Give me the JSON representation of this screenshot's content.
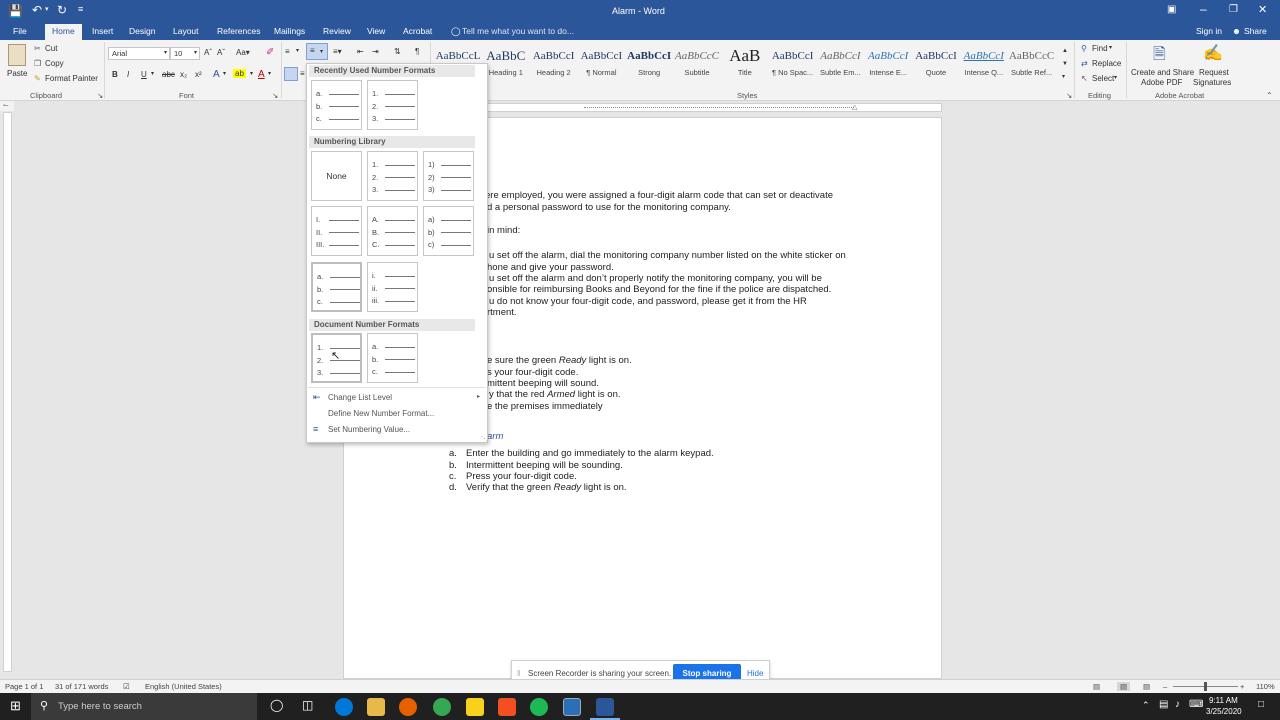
{
  "window": {
    "title": "Alarm  -  Word",
    "signin": "Sign in",
    "share": "Share"
  },
  "tabs": [
    "File",
    "Home",
    "Insert",
    "Design",
    "Layout",
    "References",
    "Mailings",
    "Review",
    "View",
    "Acrobat"
  ],
  "tell_me": "Tell me what you want to do...",
  "clipboard": {
    "paste": "Paste",
    "cut": "Cut",
    "copy": "Copy",
    "format_painter": "Format Painter",
    "label": "Clipboard"
  },
  "font": {
    "name": "Arial",
    "size": "10",
    "label": "Font"
  },
  "styles": {
    "label": "Styles",
    "items": [
      {
        "preview": "AaBbCcL",
        "name": ""
      },
      {
        "preview": "AaBbC",
        "name": "Heading 1"
      },
      {
        "preview": "AaBbCcI",
        "name": "Heading 2"
      },
      {
        "preview": "AaBbCcI",
        "name": "¶ Normal"
      },
      {
        "preview": "AaBbCcI",
        "name": "Strong"
      },
      {
        "preview": "AaBbCcC",
        "name": "Subtitle"
      },
      {
        "preview": "AaB",
        "name": "Title"
      },
      {
        "preview": "AaBbCcI",
        "name": "¶ No Spac..."
      },
      {
        "preview": "AaBbCcI",
        "name": "Subtle Em..."
      },
      {
        "preview": "AaBbCcI",
        "name": "Intense E..."
      },
      {
        "preview": "AaBbCcI",
        "name": "Quote"
      },
      {
        "preview": "AaBbCcI",
        "name": "Intense Q..."
      },
      {
        "preview": "AaBbCcC",
        "name": "Subtle Ref..."
      }
    ]
  },
  "editing": {
    "find": "Find",
    "replace": "Replace",
    "select": "Select",
    "label": "Editing"
  },
  "acrobat": {
    "create": "Create and Share",
    "create2": "Adobe PDF",
    "request": "Request",
    "request2": "Signatures",
    "label": "Adobe Acrobat"
  },
  "numbering": {
    "recent_header": "Recently Used Number Formats",
    "library_header": "Numbering Library",
    "document_header": "Document Number Formats",
    "none": "None",
    "recent": [
      [
        "a.",
        "b.",
        "c."
      ],
      [
        "1.",
        "2.",
        "3."
      ]
    ],
    "library": [
      [
        "1.",
        "2.",
        "3."
      ],
      [
        "1)",
        "2)",
        "3)"
      ],
      [
        "I.",
        "II.",
        "III."
      ],
      [
        "A.",
        "B.",
        "C."
      ],
      [
        "a)",
        "b)",
        "c)"
      ],
      [
        "a.",
        "b.",
        "c."
      ],
      [
        "i.",
        "ii.",
        "iii."
      ]
    ],
    "document": [
      [
        "1.",
        "2.",
        "3."
      ],
      [
        "a.",
        "b.",
        "c."
      ]
    ],
    "menu": [
      "Change List Level",
      "Define New Number Format...",
      "Set Numbering Value..."
    ]
  },
  "document": {
    "lines": [
      "ere employed, you were assigned a four-digit alarm code that can set or deactivate",
      "d a personal password to use for the monitoring company.",
      "in mind:",
      "u set off the alarm, dial the monitoring company number listed on the white sticker on",
      "hone and give your password.",
      "u set off the alarm and don’t properly notify the monitoring company, you will be",
      "onsible for reimbursing Books and Beyond for the fine if the police are dispatched.",
      "u do not know your four-digit code, and password, please get it from the HR",
      "rtment.",
      "e sure the green ",
      "s your four-digit code.",
      "mittent beeping will sound.",
      "y that the red ",
      "e the premises immediately"
    ],
    "ready": "Ready",
    "light_on": " light is on.",
    "armed": "Armed",
    "heading": "arm",
    "list": [
      {
        "n": "a.",
        "t": "Enter the building and go immediately to the alarm keypad."
      },
      {
        "n": "b.",
        "t": "Intermittent beeping will be sounding."
      },
      {
        "n": "c.",
        "t": "Press your four-digit code."
      },
      {
        "n": "d.",
        "t": "Verify that the green "
      }
    ]
  },
  "sharebar": {
    "text": "Screen Recorder is sharing your screen.",
    "stop": "Stop sharing",
    "hide": "Hide"
  },
  "status": {
    "page": "Page 1 of 1",
    "words": "31 of 171 words",
    "lang": "English (United States)",
    "zoom": "110%"
  },
  "taskbar": {
    "search": "Type here to search",
    "time": "9:11 AM",
    "date": "3/25/2020"
  }
}
